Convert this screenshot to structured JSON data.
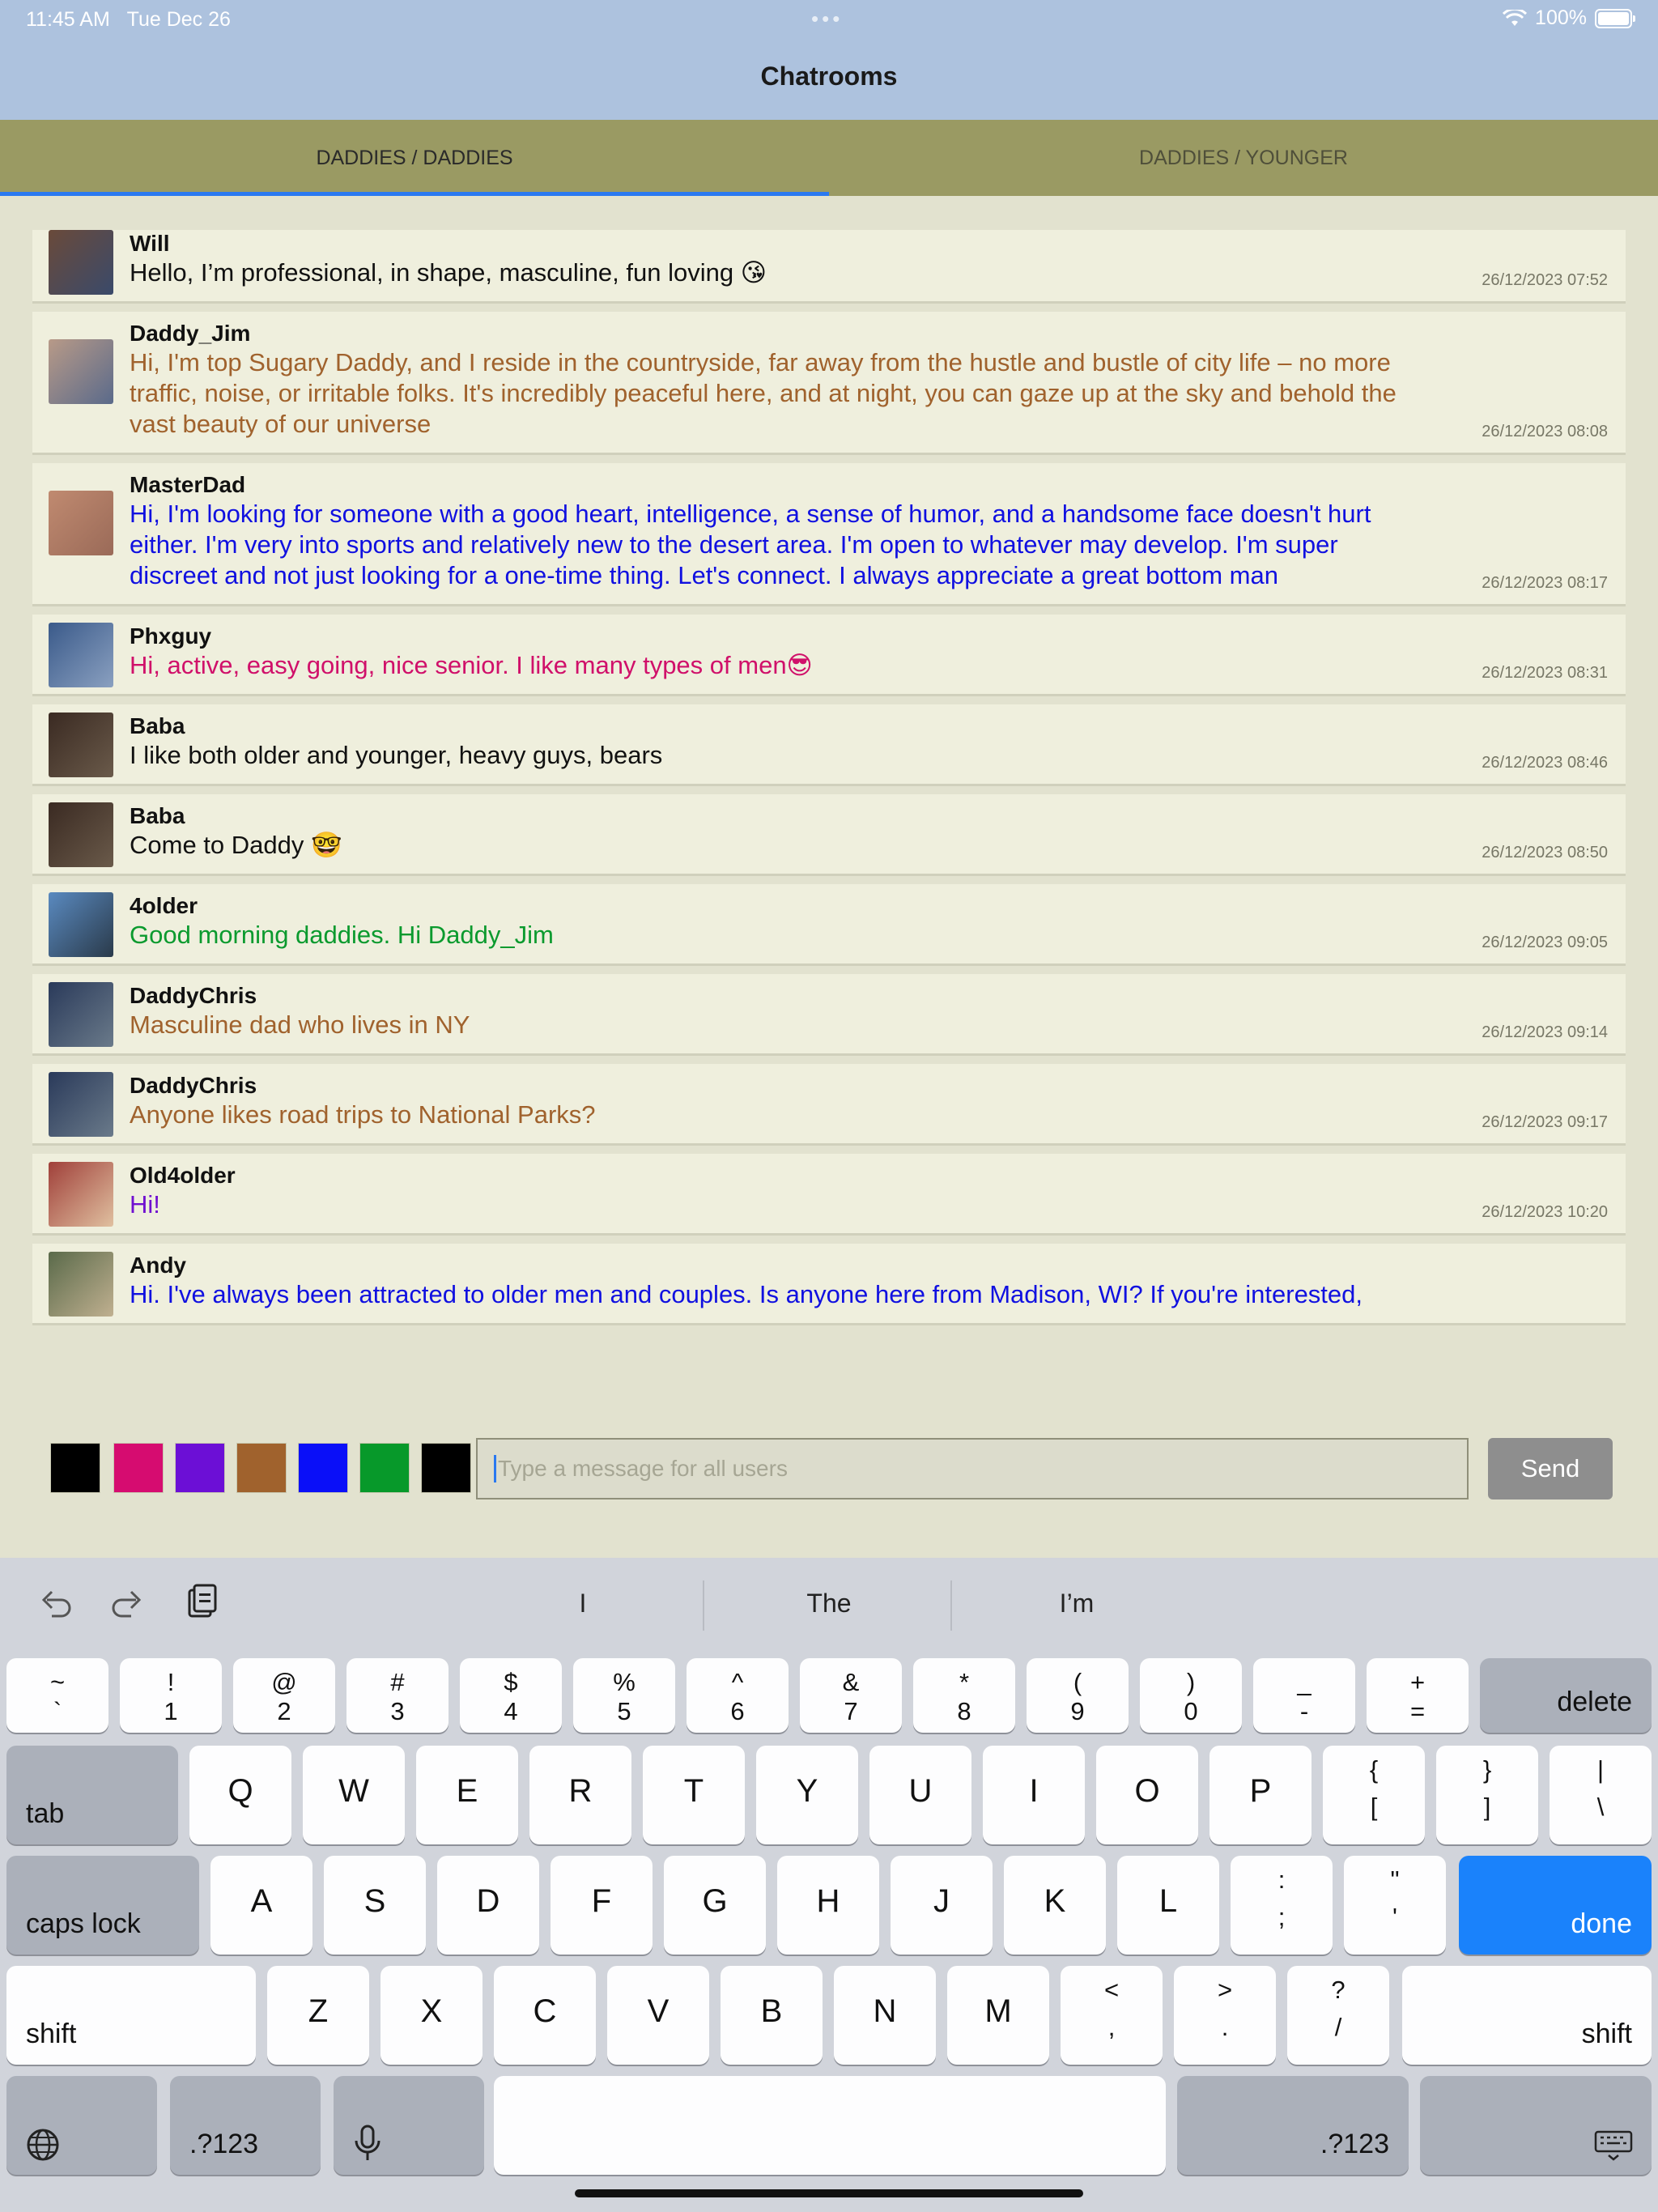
{
  "status": {
    "time": "11:45 AM",
    "date": "Tue Dec 26",
    "battery": "100%"
  },
  "nav": {
    "title": "Chatrooms"
  },
  "tabs": [
    {
      "label": "DADDIES / DADDIES",
      "active": true
    },
    {
      "label": "DADDIES / YOUNGER",
      "active": false
    }
  ],
  "messages": [
    {
      "user": "Will",
      "text": "Hello, I’m professional, in shape, masculine, fun loving 😘",
      "time": "26/12/2023 07:52",
      "color": "#111111"
    },
    {
      "user": "Daddy_Jim",
      "text": "Hi, I'm top Sugary Daddy, and I reside in the countryside, far away from the hustle and bustle of city life – no more traffic, noise, or irritable folks. It's incredibly peaceful here, and at night, you can gaze up at the sky and behold the vast beauty of our universe",
      "time": "26/12/2023 08:08",
      "color": "#a0622d"
    },
    {
      "user": "MasterDad",
      "text": "Hi, I'm looking for someone with a good heart, intelligence, a sense of humor, and a handsome face doesn't hurt either. I'm very into sports and relatively new to the desert area. I'm open to whatever may develop. I'm super discreet and not just looking for a one-time thing. Let's connect. I always appreciate a great bottom man",
      "time": "26/12/2023 08:17",
      "color": "#1010e0"
    },
    {
      "user": "Phxguy",
      "text": "Hi, active, easy going, nice senior. I like many types of men😎",
      "time": "26/12/2023 08:31",
      "color": "#d0106a"
    },
    {
      "user": "Baba",
      "text": "I like both older and younger, heavy guys, bears",
      "time": "26/12/2023 08:46",
      "color": "#111111"
    },
    {
      "user": "Baba",
      "text": "Come to Daddy 🤓",
      "time": "26/12/2023 08:50",
      "color": "#111111"
    },
    {
      "user": "4older",
      "text": "Good morning daddies. Hi Daddy_Jim",
      "time": "26/12/2023 09:05",
      "color": "#0b9a2e"
    },
    {
      "user": "DaddyChris",
      "text": "Masculine dad who lives in NY",
      "time": "26/12/2023 09:14",
      "color": "#a0622d"
    },
    {
      "user": "DaddyChris",
      "text": "Anyone likes road trips to National Parks?",
      "time": "26/12/2023 09:17",
      "color": "#a0622d"
    },
    {
      "user": "Old4older",
      "text": "Hi!",
      "time": "26/12/2023 10:20",
      "color": "#7010d0"
    },
    {
      "user": "Andy",
      "text": "Hi. I've always been attracted to older men and couples. Is anyone here from Madison, WI? If you're interested,",
      "time": "",
      "color": "#1010e0"
    }
  ],
  "colors": [
    "#000000",
    "#d60c70",
    "#6c0fd6",
    "#a0622d",
    "#0a0ff8",
    "#07992a",
    "#000000"
  ],
  "composer": {
    "placeholder": "Type a message for all users",
    "send_label": "Send"
  },
  "suggestions": [
    "I",
    "The",
    "I’m"
  ],
  "keyboard": {
    "row1": [
      [
        "~",
        "`"
      ],
      [
        "!",
        "1"
      ],
      [
        "@",
        "2"
      ],
      [
        "#",
        "3"
      ],
      [
        "$",
        "4"
      ],
      [
        "%",
        "5"
      ],
      [
        "^",
        "6"
      ],
      [
        "&",
        "7"
      ],
      [
        "*",
        "8"
      ],
      [
        "(",
        "9"
      ],
      [
        ")",
        "0"
      ],
      [
        "_",
        "-"
      ],
      [
        "+",
        "="
      ]
    ],
    "delete": "delete",
    "tab": "tab",
    "row2": [
      "Q",
      "W",
      "E",
      "R",
      "T",
      "Y",
      "U",
      "I",
      "O",
      "P"
    ],
    "row2_sym": [
      [
        "{",
        "["
      ],
      [
        "}",
        "]"
      ],
      [
        "|",
        "\\"
      ]
    ],
    "caps": "caps lock",
    "row3": [
      "A",
      "S",
      "D",
      "F",
      "G",
      "H",
      "J",
      "K",
      "L"
    ],
    "row3_sym": [
      [
        ":",
        ";"
      ],
      [
        "\"",
        "'"
      ]
    ],
    "done": "done",
    "shift": "shift",
    "row4": [
      "Z",
      "X",
      "C",
      "V",
      "B",
      "N",
      "M"
    ],
    "row4_sym": [
      [
        "<",
        ","
      ],
      [
        ">",
        "."
      ],
      [
        "?",
        "/"
      ]
    ],
    "numsym": ".?123"
  }
}
